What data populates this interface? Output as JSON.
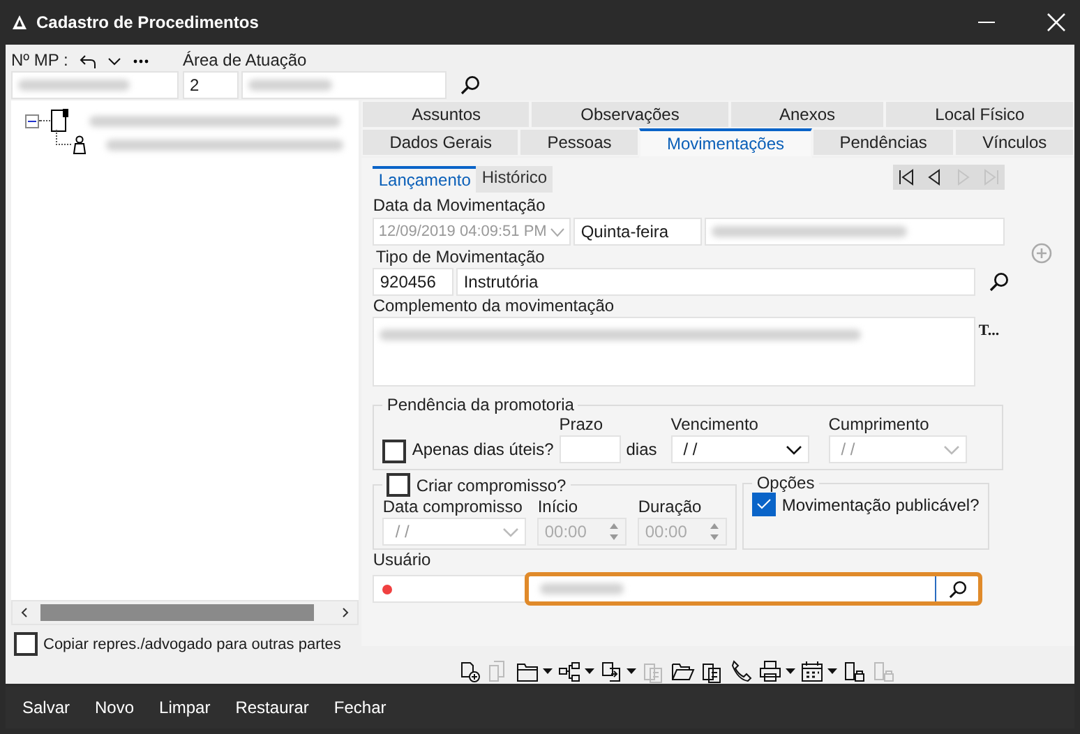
{
  "window": {
    "title": "Cadastro de Procedimentos"
  },
  "header": {
    "mp_label": "Nº MP :",
    "area_label": "Área de Atuação",
    "area_code": "2"
  },
  "tree": {
    "nodes": [
      {
        "kind": "document",
        "expanded": true,
        "children": [
          {
            "kind": "person"
          }
        ]
      }
    ]
  },
  "copy_option": {
    "label": "Copiar repres./advogado para outras partes",
    "checked": false
  },
  "tabs_row_1": [
    {
      "label": "Assuntos",
      "selected": false
    },
    {
      "label": "Observações",
      "selected": false
    },
    {
      "label": "Anexos",
      "selected": false
    },
    {
      "label": "Local Físico",
      "selected": false
    }
  ],
  "tabs_row_2": [
    {
      "label": "Dados Gerais",
      "selected": false
    },
    {
      "label": "Pessoas",
      "selected": false
    },
    {
      "label": "Movimentações",
      "selected": true
    },
    {
      "label": "Pendências",
      "selected": false
    },
    {
      "label": "Vínculos",
      "selected": false
    }
  ],
  "subtabs": [
    {
      "label": "Lançamento",
      "selected": true
    },
    {
      "label": "Histórico",
      "selected": false
    }
  ],
  "record_nav": [
    {
      "kind": "first",
      "disabled": false
    },
    {
      "kind": "prev",
      "disabled": false
    },
    {
      "kind": "next",
      "disabled": true
    },
    {
      "kind": "last",
      "disabled": true
    }
  ],
  "movement_date": {
    "label": "Data da Movimentação",
    "value": "12/09/2019 04:09:51 PM",
    "disabled": true,
    "weekday": "Quinta-feira"
  },
  "movement_type": {
    "label": "Tipo de Movimentação",
    "code": "920456",
    "name": "Instrutória"
  },
  "complement": {
    "label": "Complemento da movimentação",
    "side_text": "T..."
  },
  "pending": {
    "title": "Pendência da promotoria",
    "business_days": {
      "label": "Apenas dias úteis?",
      "checked": false
    },
    "term_label": "Prazo",
    "days_label": "dias",
    "due": {
      "label": "Vencimento",
      "value": "/ /",
      "disabled": false
    },
    "fulfilment": {
      "label": "Cumprimento",
      "value": "/ /",
      "disabled": true
    }
  },
  "appointment": {
    "label": "Criar compromisso?",
    "checked": false,
    "date": {
      "label": "Data compromisso",
      "value": "/ /"
    },
    "start": {
      "label": "Início",
      "value": "00:00"
    },
    "duration": {
      "label": "Duração",
      "value": "00:00"
    }
  },
  "options": {
    "title": "Opções",
    "publishable": {
      "label": "Movimentação publicável?",
      "checked": true
    }
  },
  "user": {
    "label": "Usuário",
    "required": true
  },
  "toolbar": [
    {
      "kind": "doc-add",
      "disabled": false,
      "menu": false
    },
    {
      "kind": "doc",
      "disabled": true,
      "menu": false
    },
    {
      "kind": "folder",
      "disabled": false,
      "menu": true
    },
    {
      "kind": "hierarchy",
      "disabled": false,
      "menu": true
    },
    {
      "kind": "transfer",
      "disabled": false,
      "menu": true
    },
    {
      "kind": "copy",
      "disabled": true,
      "menu": false
    },
    {
      "kind": "folder-open",
      "disabled": false,
      "menu": false
    },
    {
      "kind": "copy",
      "disabled": false,
      "menu": false
    },
    {
      "kind": "phone",
      "disabled": false,
      "menu": false
    },
    {
      "kind": "printer",
      "disabled": false,
      "menu": true
    },
    {
      "kind": "calendar",
      "disabled": false,
      "menu": true
    },
    {
      "kind": "doc-lock",
      "disabled": false,
      "menu": false
    },
    {
      "kind": "doc-lock",
      "disabled": true,
      "menu": false
    }
  ],
  "actions": [
    "Salvar",
    "Novo",
    "Limpar",
    "Restaurar",
    "Fechar"
  ]
}
